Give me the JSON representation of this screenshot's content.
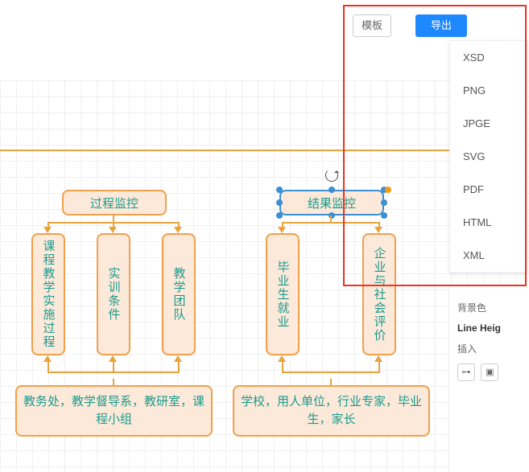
{
  "toolbar": {
    "template": "模板",
    "export": "导出"
  },
  "export_menu": [
    "XSD",
    "PNG",
    "JPGE",
    "SVG",
    "PDF",
    "HTML",
    "XML"
  ],
  "headers": {
    "process": "过程监控",
    "result": "结果监控"
  },
  "process_children": [
    "课程教学实施过程",
    "实训条件",
    "教学团队"
  ],
  "result_children": [
    "毕业生就业",
    "企业与社会评价"
  ],
  "sources": {
    "process": "教务处，教学督导系，教研室，课程小组",
    "result": "学校，用人单位，行业专家，毕业生，家长"
  },
  "sidepanel": {
    "bgcolor": "背景色",
    "lineheight": "Line Heig",
    "insert": "插入"
  },
  "colors": {
    "node_border": "#f0a04b",
    "node_fill": "#fde9d9",
    "text": "#1a9b8e",
    "line": "#e8a33d",
    "select": "#3b8fd4",
    "accent": "#1e88ff",
    "highlight": "#f03020"
  },
  "chart_data": {
    "type": "flow-diagram",
    "groups": [
      {
        "header": "过程监控",
        "children": [
          "课程教学实施过程",
          "实训条件",
          "教学团队"
        ],
        "sources": "教务处，教学督导系，教研室，课程小组"
      },
      {
        "header": "结果监控",
        "children": [
          "毕业生就业",
          "企业与社会评价"
        ],
        "sources": "学校，用人单位，行业专家，毕业生，家长",
        "selected": true
      }
    ],
    "edges": [
      {
        "from": "header",
        "to": "children",
        "dir": "down"
      },
      {
        "from": "sources",
        "to": "children",
        "dir": "up"
      }
    ]
  }
}
